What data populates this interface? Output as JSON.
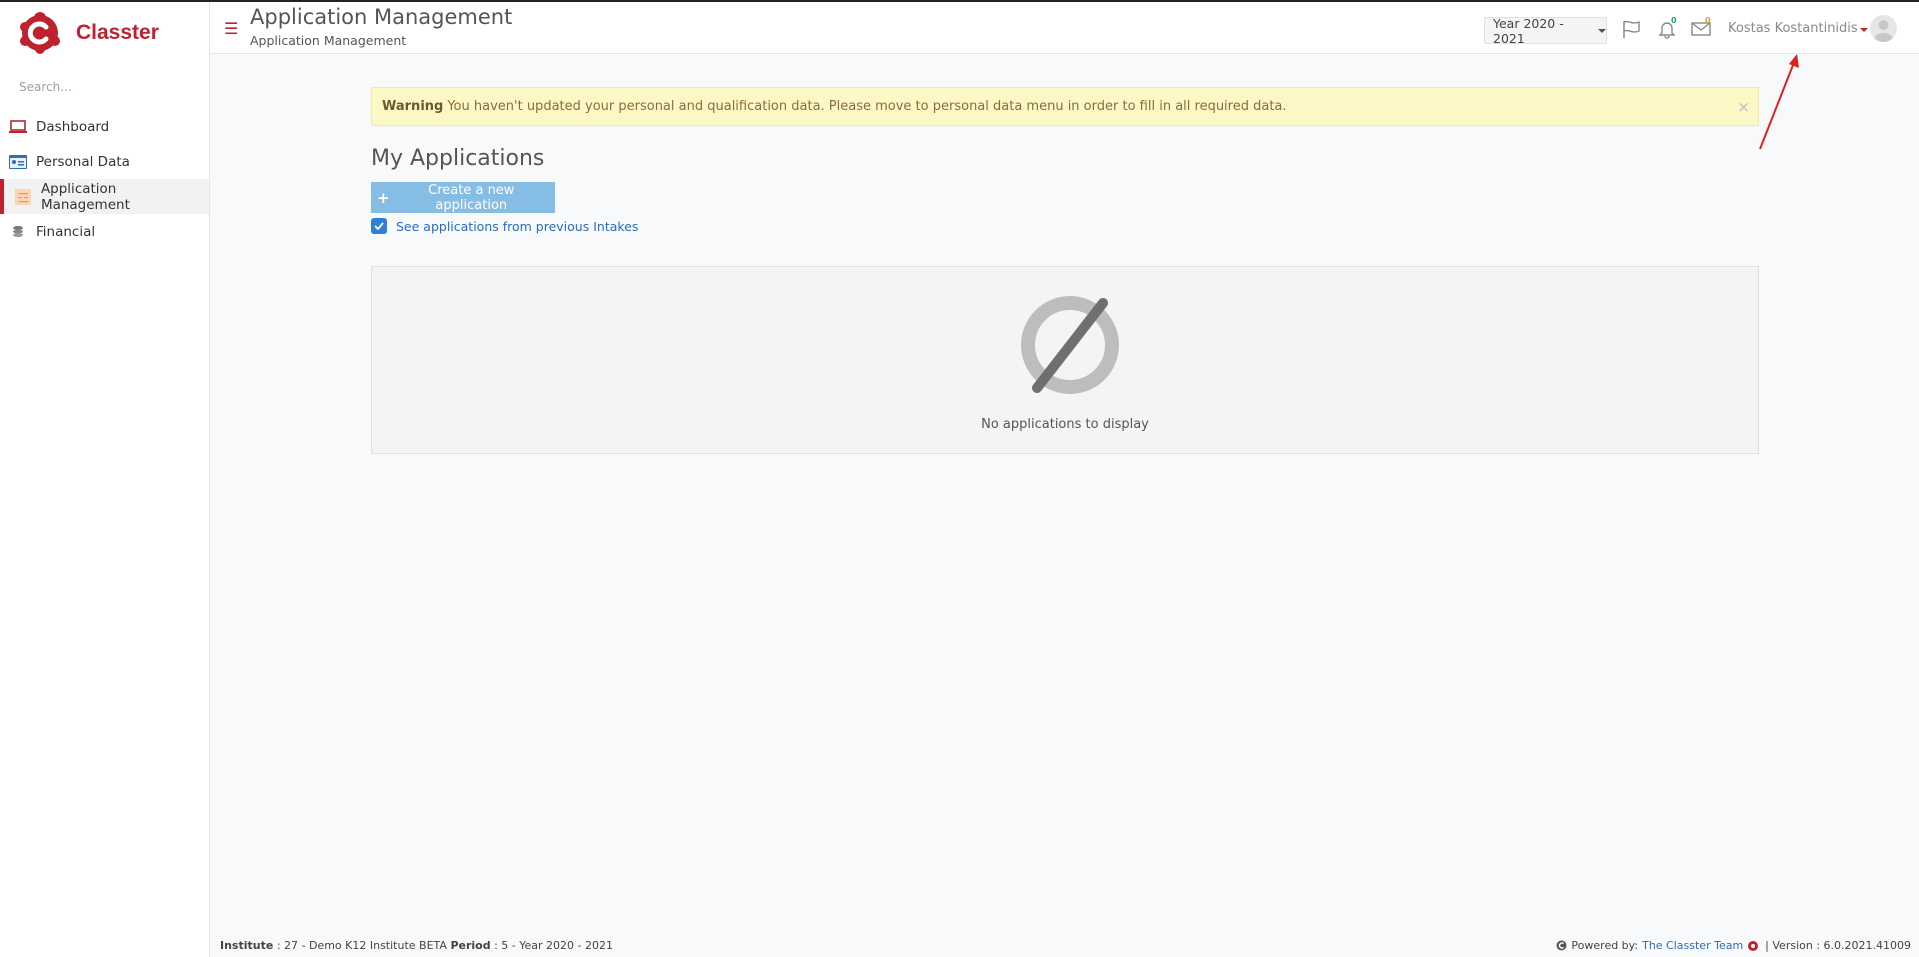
{
  "brand": {
    "name": "Classter",
    "color": "#c0212f"
  },
  "sidebar": {
    "search_placeholder": "Search...",
    "items": [
      {
        "label": "Dashboard",
        "icon": "laptop-icon",
        "active": false
      },
      {
        "label": "Personal Data",
        "icon": "id-card-icon",
        "active": false
      },
      {
        "label": "Application Management",
        "icon": "form-icon",
        "active": true
      },
      {
        "label": "Financial",
        "icon": "coins-icon",
        "active": false
      }
    ]
  },
  "header": {
    "title": "Application Management",
    "subtitle": "Application Management",
    "year_select": "Year 2020 - 2021",
    "notifications_count": "0",
    "messages_count": "0",
    "username": "Kostas Kostantinidis"
  },
  "main": {
    "warning_title": "Warning",
    "warning_text": "You haven't updated your personal and qualification data. Please move to personal data menu in order to fill in all required data.",
    "close_symbol": "×",
    "section_title": "My Applications",
    "create_button": "Create a new application",
    "checkbox_label": "See applications from previous Intakes",
    "checkbox_checked": true,
    "empty_text": "No applications to display"
  },
  "footer": {
    "institute_label": "Institute",
    "institute_value": ": 27 - Demo K12 Institute BETA",
    "period_label": "Period",
    "period_value": ": 5 - Year 2020 - 2021",
    "powered_by": "Powered by:",
    "team_link": "The Classter Team",
    "version": "| Version : 6.0.2021.41009"
  }
}
